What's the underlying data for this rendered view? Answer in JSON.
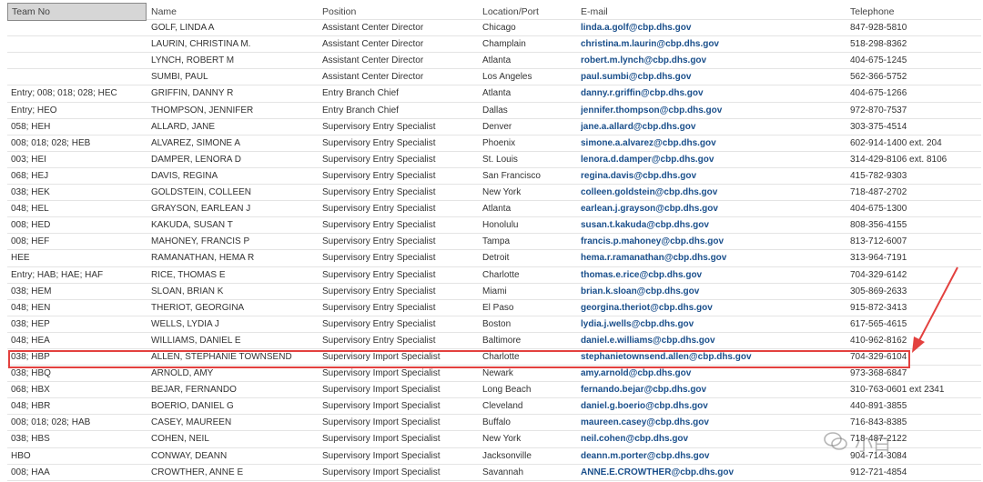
{
  "headers": {
    "team": "Team No",
    "name": "Name",
    "position": "Position",
    "location": "Location/Port",
    "email": "E-mail",
    "telephone": "Telephone"
  },
  "rows": [
    {
      "team": "",
      "name": "GOLF, LINDA A",
      "position": "Assistant Center Director",
      "location": "Chicago",
      "email": "linda.a.golf@cbp.dhs.gov",
      "telephone": "847-928-5810"
    },
    {
      "team": "",
      "name": "LAURIN, CHRISTINA M.",
      "position": "Assistant Center Director",
      "location": "Champlain",
      "email": "christina.m.laurin@cbp.dhs.gov",
      "telephone": "518-298-8362"
    },
    {
      "team": "",
      "name": "LYNCH, ROBERT M",
      "position": "Assistant Center Director",
      "location": "Atlanta",
      "email": "robert.m.lynch@cbp.dhs.gov",
      "telephone": "404-675-1245"
    },
    {
      "team": "",
      "name": "SUMBI, PAUL",
      "position": "Assistant Center Director",
      "location": "Los Angeles",
      "email": "paul.sumbi@cbp.dhs.gov",
      "telephone": "562-366-5752"
    },
    {
      "team": "Entry; 008; 018; 028; HEC",
      "name": "GRIFFIN, DANNY R",
      "position": "Entry Branch Chief",
      "location": "Atlanta",
      "email": "danny.r.griffin@cbp.dhs.gov",
      "telephone": "404-675-1266"
    },
    {
      "team": "Entry; HEO",
      "name": "THOMPSON, JENNIFER",
      "position": "Entry Branch Chief",
      "location": "Dallas",
      "email": "jennifer.thompson@cbp.dhs.gov",
      "telephone": "972-870-7537"
    },
    {
      "team": "058; HEH",
      "name": "ALLARD, JANE",
      "position": "Supervisory Entry Specialist",
      "location": "Denver",
      "email": "jane.a.allard@cbp.dhs.gov",
      "telephone": "303-375-4514"
    },
    {
      "team": "008; 018; 028; HEB",
      "name": "ALVAREZ, SIMONE A",
      "position": "Supervisory Entry Specialist",
      "location": "Phoenix",
      "email": "simone.a.alvarez@cbp.dhs.gov",
      "telephone": "602-914-1400 ext. 204"
    },
    {
      "team": "003; HEI",
      "name": "DAMPER, LENORA D",
      "position": "Supervisory Entry Specialist",
      "location": "St. Louis",
      "email": "lenora.d.damper@cbp.dhs.gov",
      "telephone": "314-429-8106 ext. 8106"
    },
    {
      "team": "068; HEJ",
      "name": "DAVIS, REGINA",
      "position": "Supervisory Entry Specialist",
      "location": "San Francisco",
      "email": "regina.davis@cbp.dhs.gov",
      "telephone": "415-782-9303"
    },
    {
      "team": "038; HEK",
      "name": "GOLDSTEIN, COLLEEN",
      "position": "Supervisory Entry Specialist",
      "location": "New York",
      "email": "colleen.goldstein@cbp.dhs.gov",
      "telephone": "718-487-2702"
    },
    {
      "team": "048; HEL",
      "name": "GRAYSON, EARLEAN J",
      "position": "Supervisory Entry Specialist",
      "location": "Atlanta",
      "email": "earlean.j.grayson@cbp.dhs.gov",
      "telephone": "404-675-1300"
    },
    {
      "team": "008; HED",
      "name": "KAKUDA, SUSAN T",
      "position": "Supervisory Entry Specialist",
      "location": "Honolulu",
      "email": "susan.t.kakuda@cbp.dhs.gov",
      "telephone": "808-356-4155"
    },
    {
      "team": "008; HEF",
      "name": "MAHONEY, FRANCIS P",
      "position": "Supervisory Entry Specialist",
      "location": "Tampa",
      "email": "francis.p.mahoney@cbp.dhs.gov",
      "telephone": "813-712-6007"
    },
    {
      "team": "HEE",
      "name": "RAMANATHAN, HEMA R",
      "position": "Supervisory Entry Specialist",
      "location": "Detroit",
      "email": "hema.r.ramanathan@cbp.dhs.gov",
      "telephone": "313-964-7191"
    },
    {
      "team": "Entry; HAB; HAE; HAF",
      "name": "RICE, THOMAS E",
      "position": "Supervisory Entry Specialist",
      "location": "Charlotte",
      "email": "thomas.e.rice@cbp.dhs.gov",
      "telephone": "704-329-6142"
    },
    {
      "team": "038; HEM",
      "name": "SLOAN, BRIAN K",
      "position": "Supervisory Entry Specialist",
      "location": "Miami",
      "email": "brian.k.sloan@cbp.dhs.gov",
      "telephone": "305-869-2633"
    },
    {
      "team": "048; HEN",
      "name": "THERIOT, GEORGINA",
      "position": "Supervisory Entry Specialist",
      "location": "El Paso",
      "email": "georgina.theriot@cbp.dhs.gov",
      "telephone": "915-872-3413"
    },
    {
      "team": "038; HEP",
      "name": "WELLS, LYDIA J",
      "position": "Supervisory Entry Specialist",
      "location": "Boston",
      "email": "lydia.j.wells@cbp.dhs.gov",
      "telephone": "617-565-4615"
    },
    {
      "team": "048; HEA",
      "name": "WILLIAMS, DANIEL E",
      "position": "Supervisory Entry Specialist",
      "location": "Baltimore",
      "email": "daniel.e.williams@cbp.dhs.gov",
      "telephone": "410-962-8162"
    },
    {
      "team": "038; HBP",
      "name": "ALLEN, STEPHANIE TOWNSEND",
      "position": "Supervisory Import Specialist",
      "location": "Charlotte",
      "email": "stephanietownsend.allen@cbp.dhs.gov",
      "telephone": "704-329-6104"
    },
    {
      "team": "038; HBQ",
      "name": "ARNOLD, AMY",
      "position": "Supervisory Import Specialist",
      "location": "Newark",
      "email": "amy.arnold@cbp.dhs.gov",
      "telephone": "973-368-6847"
    },
    {
      "team": "068; HBX",
      "name": "BEJAR, FERNANDO",
      "position": "Supervisory Import Specialist",
      "location": "Long Beach",
      "email": "fernando.bejar@cbp.dhs.gov",
      "telephone": "310-763-0601 ext 2341"
    },
    {
      "team": "048; HBR",
      "name": "BOERIO, DANIEL G",
      "position": "Supervisory Import Specialist",
      "location": "Cleveland",
      "email": "daniel.g.boerio@cbp.dhs.gov",
      "telephone": "440-891-3855"
    },
    {
      "team": "008; 018; 028; HAB",
      "name": "CASEY, MAUREEN",
      "position": "Supervisory Import Specialist",
      "location": "Buffalo",
      "email": "maureen.casey@cbp.dhs.gov",
      "telephone": "716-843-8385"
    },
    {
      "team": "038; HBS",
      "name": "COHEN, NEIL",
      "position": "Supervisory Import Specialist",
      "location": "New York",
      "email": "neil.cohen@cbp.dhs.gov",
      "telephone": "718-487-2122"
    },
    {
      "team": "HBO",
      "name": "CONWAY, DEANN",
      "position": "Supervisory Import Specialist",
      "location": "Jacksonville",
      "email": "deann.m.porter@cbp.dhs.gov",
      "telephone": "904-714-3084"
    },
    {
      "team": "008; HAA",
      "name": "CROWTHER, ANNE E",
      "position": "Supervisory Import Specialist",
      "location": "Savannah",
      "email": "ANNE.E.CROWTHER@cbp.dhs.gov",
      "telephone": "912-721-4854"
    }
  ],
  "highlight": {
    "row_index": 20,
    "color": "#e3413f"
  },
  "watermark": {
    "text": "小白",
    "icon": "wechat-icon"
  }
}
